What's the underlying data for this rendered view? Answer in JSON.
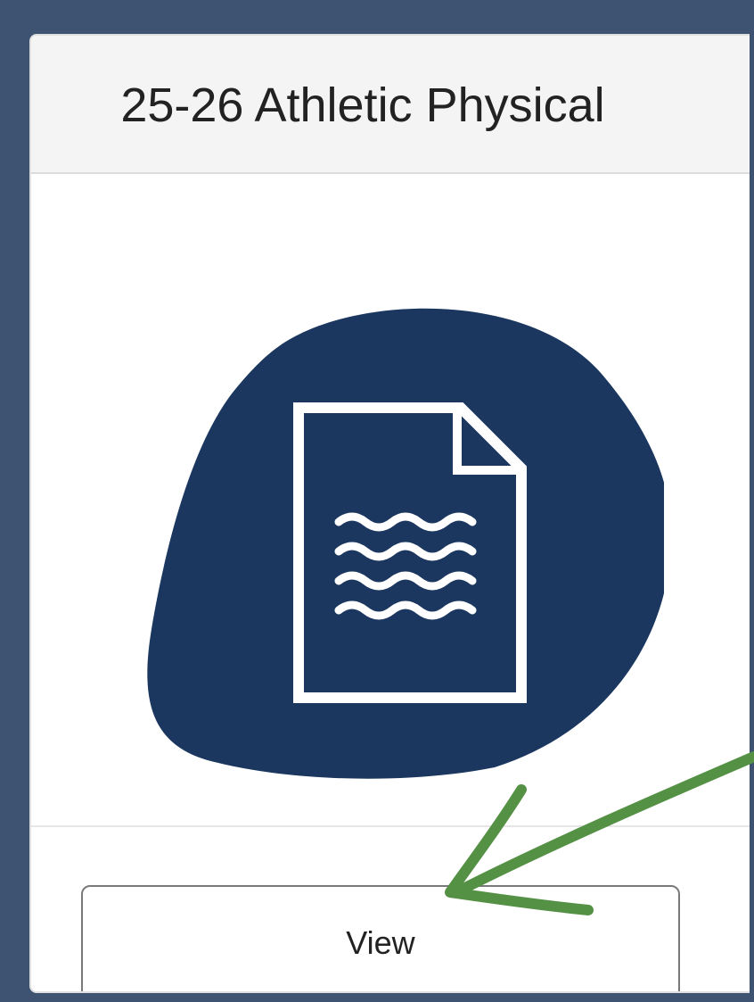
{
  "card": {
    "title": "25-26 Athletic Physical",
    "illustration_icon": "document-icon",
    "blob_color": "#1b375f",
    "view_button_label": "View"
  },
  "annotation": {
    "arrow_icon": "arrow-icon",
    "arrow_color": "#559145"
  },
  "page_background": "#3e5272"
}
